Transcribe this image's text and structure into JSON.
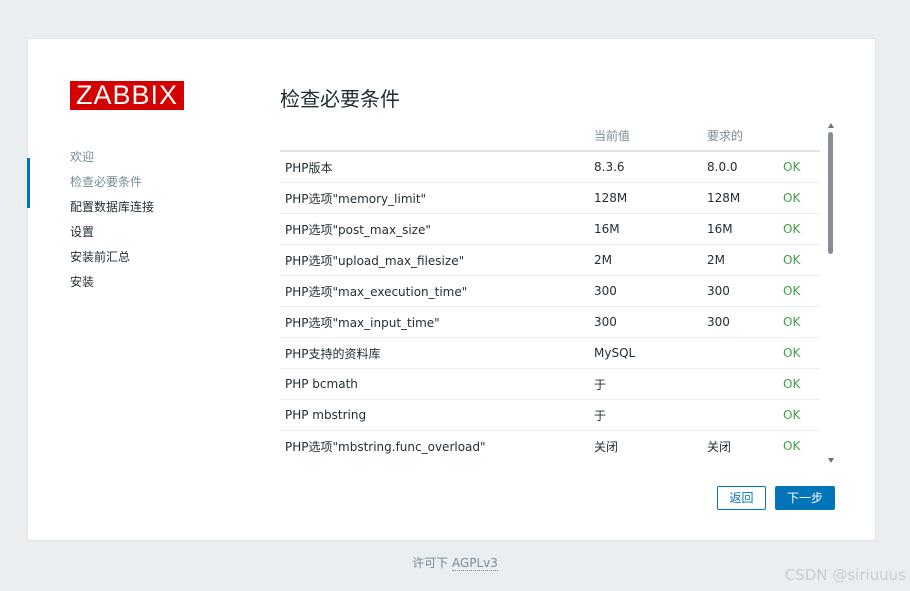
{
  "brand": "ZABBIX",
  "steps": [
    {
      "label": "欢迎",
      "state": "done"
    },
    {
      "label": "检查必要条件",
      "state": "active"
    },
    {
      "label": "配置数据库连接",
      "state": "todo"
    },
    {
      "label": "设置",
      "state": "todo"
    },
    {
      "label": "安装前汇总",
      "state": "todo"
    },
    {
      "label": "安装",
      "state": "todo"
    }
  ],
  "page_title": "检查必要条件",
  "table": {
    "headers": [
      "",
      "当前值",
      "要求的",
      ""
    ],
    "rows": [
      [
        "PHP版本",
        "8.3.6",
        "8.0.0",
        "OK"
      ],
      [
        "PHP选项\"memory_limit\"",
        "128M",
        "128M",
        "OK"
      ],
      [
        "PHP选项\"post_max_size\"",
        "16M",
        "16M",
        "OK"
      ],
      [
        "PHP选项\"upload_max_filesize\"",
        "2M",
        "2M",
        "OK"
      ],
      [
        "PHP选项\"max_execution_time\"",
        "300",
        "300",
        "OK"
      ],
      [
        "PHP选项\"max_input_time\"",
        "300",
        "300",
        "OK"
      ],
      [
        "PHP支持的资料库",
        "MySQL",
        "",
        "OK"
      ],
      [
        "PHP bcmath",
        "于",
        "",
        "OK"
      ],
      [
        "PHP mbstring",
        "于",
        "",
        "OK"
      ],
      [
        "PHP选项\"mbstring.func_overload\"",
        "关闭",
        "关闭",
        "OK"
      ],
      [
        "",
        "",
        "",
        ""
      ]
    ]
  },
  "buttons": {
    "back": "返回",
    "next": "下一步"
  },
  "footer": {
    "prefix": "许可下",
    "link": "AGPLv3"
  },
  "watermark": "CSDN @siriuuus",
  "colors": {
    "brand": "#d40000",
    "accent": "#0275b8",
    "ok": "#429e47"
  }
}
